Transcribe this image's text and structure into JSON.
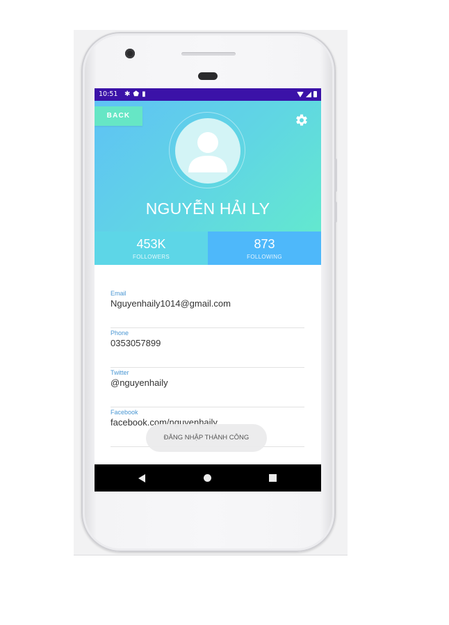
{
  "status_bar": {
    "time": "10:51",
    "left_icons": [
      "gear-icon",
      "shield-icon",
      "sd-card-icon"
    ],
    "right_icons": [
      "wifi-icon",
      "signal-icon",
      "battery-icon"
    ]
  },
  "header": {
    "back_label": "BACK",
    "name": "NGUYỄN HẢI LY",
    "colors": {
      "gradient_start": "#5fc2f5",
      "gradient_end": "#63e8cf",
      "back_button": "#66e6c5"
    }
  },
  "stats": [
    {
      "value": "453K",
      "label": "FOLLOWERS"
    },
    {
      "value": "873",
      "label": "FOLLOWING"
    }
  ],
  "fields": [
    {
      "label": "Email",
      "value": "Nguyenhaily1014@gmail.com"
    },
    {
      "label": "Phone",
      "value": "0353057899"
    },
    {
      "label": "Twitter",
      "value": "@nguyenhaily"
    },
    {
      "label": "Facebook",
      "value": "facebook.com/nguyenhaily"
    }
  ],
  "toast": {
    "text": "ĐĂNG NHẬP THÀNH CÔNG"
  },
  "nav_bar": {
    "buttons": [
      "back-icon",
      "home-icon",
      "recents-icon"
    ]
  }
}
